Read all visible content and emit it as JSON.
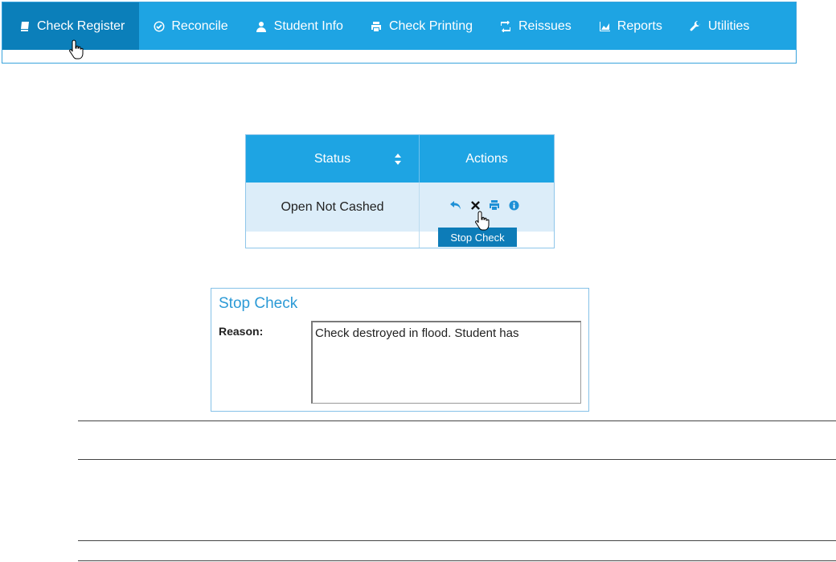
{
  "nav": {
    "items": [
      {
        "label": "Check Register",
        "icon": "book-icon",
        "active": true
      },
      {
        "label": "Reconcile",
        "icon": "check-circle-icon",
        "active": false
      },
      {
        "label": "Student Info",
        "icon": "user-icon",
        "active": false
      },
      {
        "label": "Check Printing",
        "icon": "printer-icon",
        "active": false
      },
      {
        "label": "Reissues",
        "icon": "retweet-icon",
        "active": false
      },
      {
        "label": "Reports",
        "icon": "area-chart-icon",
        "active": false
      },
      {
        "label": "Utilities",
        "icon": "wrench-icon",
        "active": false
      }
    ]
  },
  "table": {
    "headers": {
      "status": "Status",
      "actions": "Actions"
    },
    "row": {
      "status": "Open Not Cashed"
    },
    "action_icons": [
      "reply-icon",
      "times-icon",
      "printer-icon",
      "info-circle-icon"
    ],
    "tooltip": "Stop Check"
  },
  "stop_check": {
    "title": "Stop Check",
    "reason_label": "Reason:",
    "reason_value": "Check destroyed in flood. Student has"
  },
  "colors": {
    "nav_bg": "#1ea4e3",
    "nav_active": "#0b7fba",
    "row_highlight": "#dcedf9",
    "tooltip_bg": "#0d7cb8",
    "title_blue": "#2c9ad6"
  }
}
